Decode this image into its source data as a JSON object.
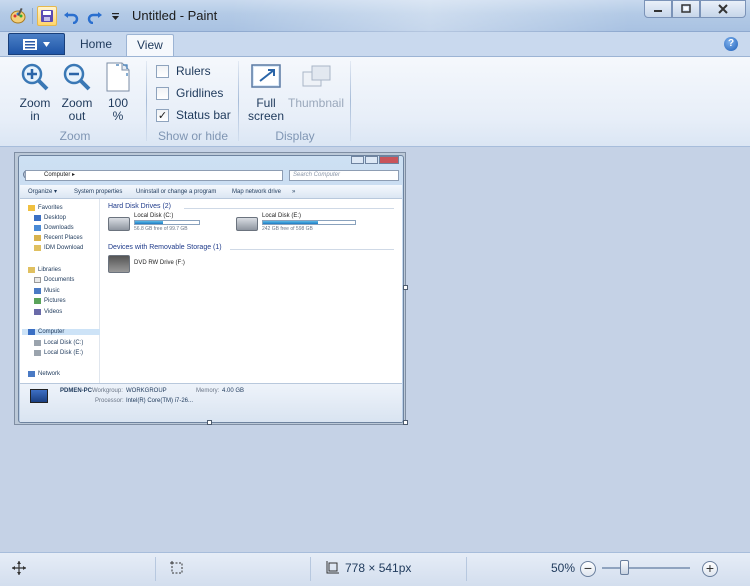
{
  "window": {
    "title": "Untitled - Paint"
  },
  "tabs": {
    "home": "Home",
    "view": "View"
  },
  "ribbon": {
    "zoom_group": {
      "label": "Zoom",
      "zoom_in": [
        "Zoom",
        "in"
      ],
      "zoom_out": [
        "Zoom",
        "out"
      ],
      "hundred": [
        "100",
        "%"
      ]
    },
    "show_hide_group": {
      "label": "Show or hide",
      "rulers": {
        "label": "Rulers",
        "checked": false
      },
      "gridlines": {
        "label": "Gridlines",
        "checked": false
      },
      "status_bar": {
        "label": "Status bar",
        "checked": true
      }
    },
    "display_group": {
      "label": "Display",
      "full_screen": [
        "Full",
        "screen"
      ],
      "thumbnail": "Thumbnail"
    }
  },
  "canvas_image": {
    "address": "Computer ▸",
    "search_placeholder": "Search Computer",
    "toolbar": {
      "organize": "Organize ▾",
      "system_properties": "System properties",
      "uninstall": "Uninstall or change a program",
      "map_drive": "Map network drive",
      "more": "»"
    },
    "nav": {
      "favorites": "Favorites",
      "desktop": "Desktop",
      "downloads": "Downloads",
      "recent_places": "Recent Places",
      "idm_download": "IDM Download",
      "libraries": "Libraries",
      "documents": "Documents",
      "music": "Music",
      "pictures": "Pictures",
      "videos": "Videos",
      "computer": "Computer",
      "local_c": "Local Disk (C:)",
      "local_e": "Local Disk (E:)",
      "network": "Network"
    },
    "hard_disk_title": "Hard Disk Drives (2)",
    "drives": [
      {
        "name": "Local Disk (C:)",
        "free": "56.8 GB free of 99.7 GB",
        "used_fraction": 0.43
      },
      {
        "name": "Local Disk (E:)",
        "free": "242 GB free of 598 GB",
        "used_fraction": 0.6
      }
    ],
    "removable_title": "Devices with Removable Storage (1)",
    "dvd": "DVD RW Drive (F:)",
    "details": {
      "pc_name": "PDMEN-PC",
      "workgroup_label": "Workgroup:",
      "workgroup": "WORKGROUP",
      "memory_label": "Memory:",
      "memory": "4.00 GB",
      "processor_label": "Processor:",
      "processor": "Intel(R) Core(TM) i7-26..."
    }
  },
  "statusbar": {
    "image_size": "778 × 541px",
    "zoom": "50%",
    "zoom_fraction": 0.5
  }
}
